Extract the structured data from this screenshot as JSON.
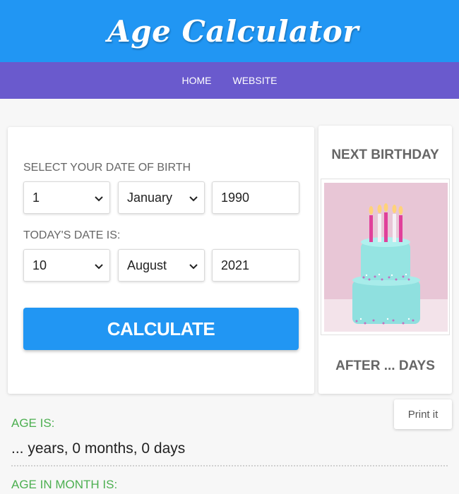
{
  "header": {
    "title": "Age Calculator"
  },
  "nav": {
    "items": [
      "HOME",
      "WEBSITE"
    ]
  },
  "form": {
    "dob_label": "SELECT YOUR DATE OF BIRTH",
    "dob": {
      "day": "1",
      "month": "January",
      "year": "1990"
    },
    "today_label": "TODAY'S DATE IS:",
    "today": {
      "day": "10",
      "month": "August",
      "year": "2021"
    },
    "calculate_label": "CALCULATE"
  },
  "side": {
    "title": "NEXT BIRTHDAY",
    "after_text": "AFTER ... DAYS"
  },
  "results": {
    "print_label": "Print it",
    "age_label": "AGE IS:",
    "age_value": "... years, 0 months, 0 days",
    "age_month_label": "AGE IN MONTH IS:"
  },
  "colors": {
    "header_bg": "#2196f3",
    "nav_bg": "#6a5acd",
    "button_bg": "#2196f3",
    "result_label": "#4caf50"
  }
}
